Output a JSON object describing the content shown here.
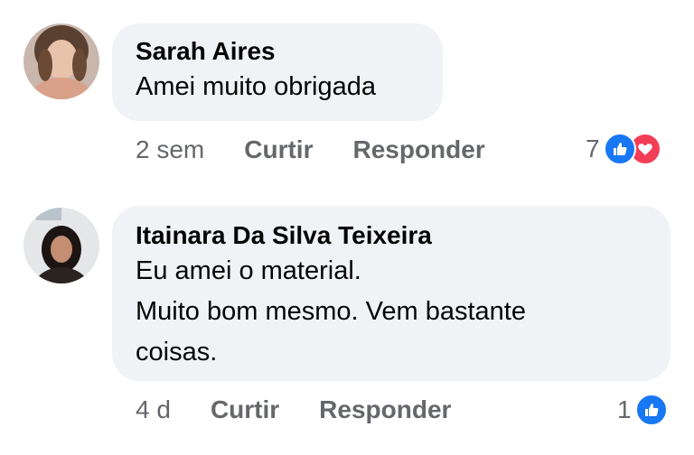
{
  "comments": [
    {
      "author": "Sarah Aires",
      "lines": [
        "Amei muito obrigada"
      ],
      "time": "2 sem",
      "like_label": "Curtir",
      "reply_label": "Responder",
      "reaction_count": "7",
      "reactions": [
        "like-icon",
        "love-icon"
      ]
    },
    {
      "author": "Itainara Da Silva Teixeira",
      "lines": [
        "Eu amei o material.",
        "Muito bom mesmo. Vem bastante",
        "coisas."
      ],
      "time": "4 d",
      "like_label": "Curtir",
      "reply_label": "Responder",
      "reaction_count": "1",
      "reactions": [
        "like-icon"
      ]
    }
  ],
  "colors": {
    "bubble": "#f0f2f5",
    "meta_text": "#65676b",
    "like_blue": "#1877f2",
    "love_red": "#f33e58"
  }
}
